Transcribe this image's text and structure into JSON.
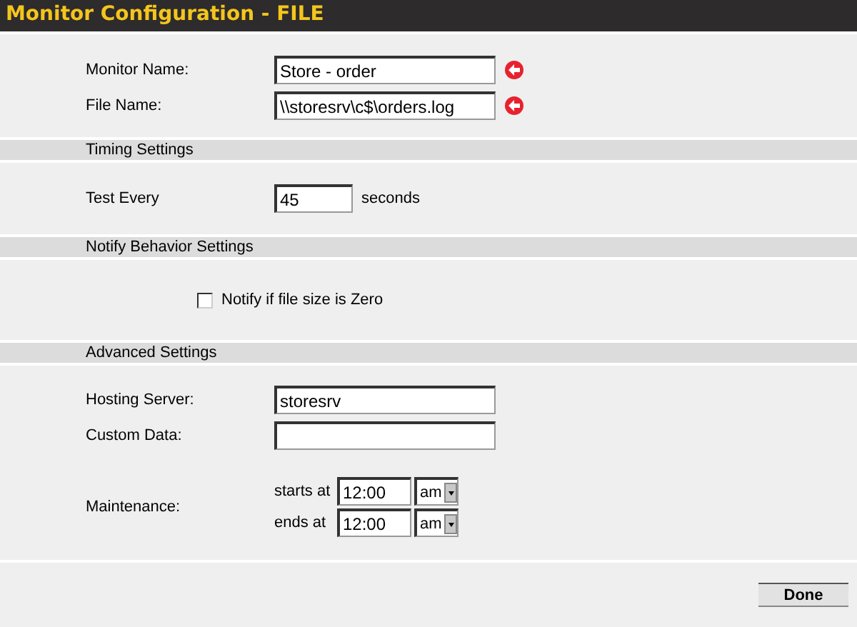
{
  "window": {
    "title": "Monitor Configuration - FILE"
  },
  "sections": [
    {
      "fields": [
        {
          "kind": "text",
          "label": "Monitor Name:",
          "value": "Store - order",
          "required": true
        },
        {
          "kind": "text",
          "label": "File Name:",
          "value": "\\\\storesrv\\c$\\orders.log",
          "required": true
        }
      ]
    },
    {
      "heading": "Timing Settings",
      "fields": [
        {
          "kind": "text",
          "label": "Test Every",
          "value": "45",
          "unit": "seconds"
        }
      ]
    },
    {
      "heading": "Notify Behavior Settings",
      "fields": [
        {
          "kind": "checkbox",
          "label": "Notify if file size is Zero",
          "checked": false
        }
      ]
    },
    {
      "heading": "Advanced Settings",
      "fields": [
        {
          "kind": "text",
          "label": "Hosting Server:",
          "value": "storesrv"
        },
        {
          "kind": "text",
          "label": "Custom Data:"
        },
        {
          "kind": "schedule",
          "label": "Maintenance:",
          "times": [
            {
              "prefix": "starts at",
              "time": "12:00",
              "period": "am"
            },
            {
              "prefix": "ends at",
              "time": "12:00",
              "period": "am"
            }
          ]
        }
      ]
    }
  ],
  "buttons": [
    {
      "label": "Done"
    }
  ]
}
